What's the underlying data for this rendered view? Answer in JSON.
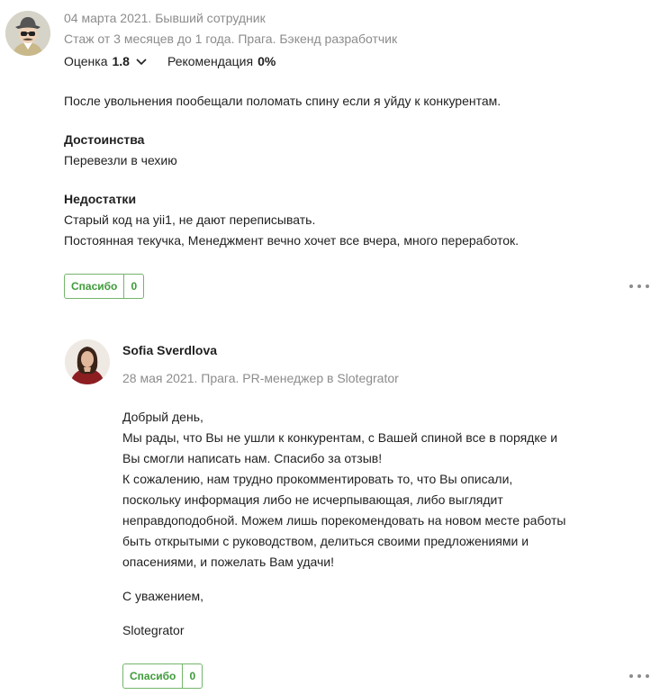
{
  "review": {
    "date_status": "04 марта 2021. Бывший сотрудник",
    "experience": "Стаж от 3 месяцев до 1 года. Прага. Бэкенд разработчик",
    "rating_label": "Оценка",
    "rating_value": "1.8",
    "recommend_label": "Рекомендация",
    "recommend_value": "0%",
    "body": "После увольнения пообещали поломать спину если я уйду к конкурентам.",
    "pros_title": "Достоинства",
    "pros_text": "Перевезли в чехию",
    "cons_title": "Недостатки",
    "cons_lines": [
      "Старый код на yii1, не дают переписывать.",
      "Постоянная текучка, Менеджмент вечно хочет все вчера, много переработок."
    ],
    "thanks_label": "Спасибо",
    "thanks_count": "0"
  },
  "reply": {
    "author": "Sofia Sverdlova",
    "meta": "28 мая 2021. Прага. PR-менеджер в Slotegrator",
    "paragraph_lines": [
      "Добрый день,",
      "Мы рады, что Вы не ушли к конкурентам, с Вашей спиной все в порядке и",
      "Вы смогли написать нам. Спасибо за отзыв!",
      "К сожалению, нам трудно прокомментировать то, что Вы описали,",
      "поскольку информация либо не исчерпывающая, либо выглядит",
      "неправдоподобной. Можем лишь порекомендовать на новом месте работы",
      "быть открытыми с руководством, делиться своими предложениями и",
      "опасениями, и пожелать Вам удачи!"
    ],
    "regards": "С уважением,",
    "signature": "Slotegrator",
    "thanks_label": "Спасибо",
    "thanks_count": "0"
  },
  "icons": {
    "anonymous_avatar": "spy-avatar-icon",
    "rating_toggle": "chevron-down-icon",
    "more_menu": "more-dots-icon"
  },
  "colors": {
    "accent_green": "#3f9b3a",
    "muted_text": "#8c8c8c",
    "main_text": "#1f1f1f"
  }
}
